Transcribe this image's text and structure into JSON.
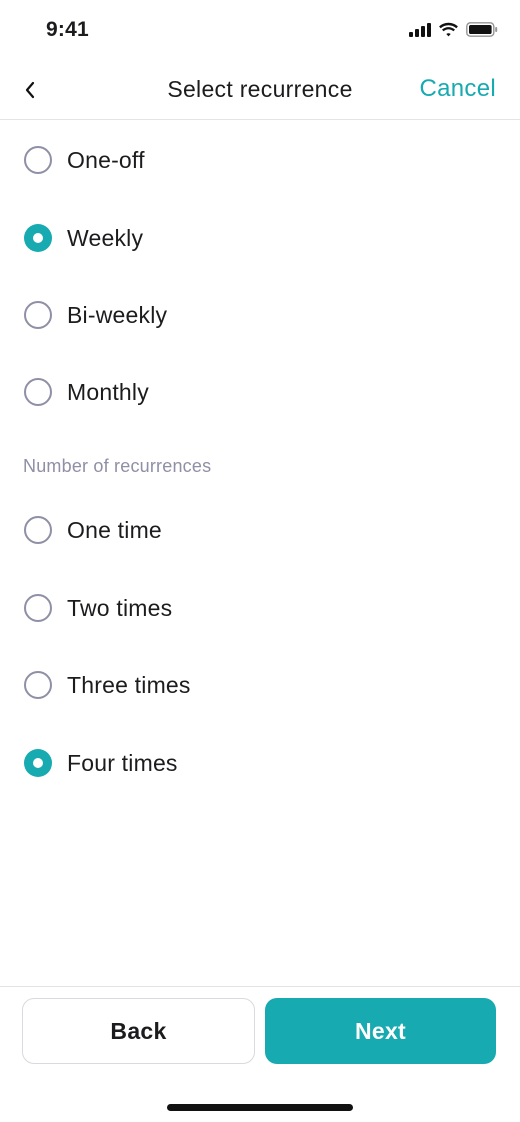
{
  "status_bar": {
    "time": "9:41"
  },
  "header": {
    "back_icon": "chevron-left-icon",
    "title": "Select recurrence",
    "cancel_label": "Cancel"
  },
  "frequency_options": [
    {
      "label": "One-off",
      "selected": false
    },
    {
      "label": "Weekly",
      "selected": true
    },
    {
      "label": "Bi-weekly",
      "selected": false
    },
    {
      "label": "Monthly",
      "selected": false
    }
  ],
  "recurrences_section": {
    "label": "Number of recurrences",
    "options": [
      {
        "label": "One time",
        "selected": false
      },
      {
        "label": "Two times",
        "selected": false
      },
      {
        "label": "Three times",
        "selected": false
      },
      {
        "label": "Four times",
        "selected": true
      }
    ]
  },
  "footer": {
    "back_label": "Back",
    "next_label": "Next"
  },
  "colors": {
    "accent": "#17aab0",
    "muted": "#8f8fa6",
    "text": "#1c1c1e",
    "divider": "#e4e4e8"
  }
}
